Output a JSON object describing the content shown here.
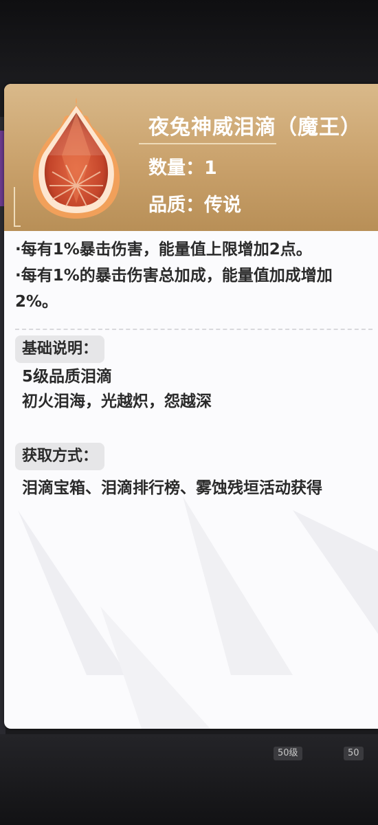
{
  "item": {
    "name": "夜兔神威泪滴（魔王）",
    "quantity": "数量：1",
    "quality": "品质：传说"
  },
  "effects": [
    "·每有1%暴击伤害，能量值上限增加2点。",
    "·每有1%的暴击伤害总加成，能量值加成增加2%。"
  ],
  "basic_info": {
    "label": "基础说明：",
    "lines": [
      "5级品质泪滴",
      "初火泪海，光越炽，怨越深"
    ]
  },
  "obtain": {
    "label": "获取方式：",
    "text": "泪滴宝箱、泪滴排行榜、雾蚀残垣活动获得"
  },
  "background": {
    "level_tag_1": "50级",
    "level_tag_2": "50"
  },
  "colors": {
    "header_gold": "#c9a16b",
    "gem_red": "#c4452a",
    "flame_orange": "#f08030",
    "text_dark": "#2a2a2a"
  }
}
